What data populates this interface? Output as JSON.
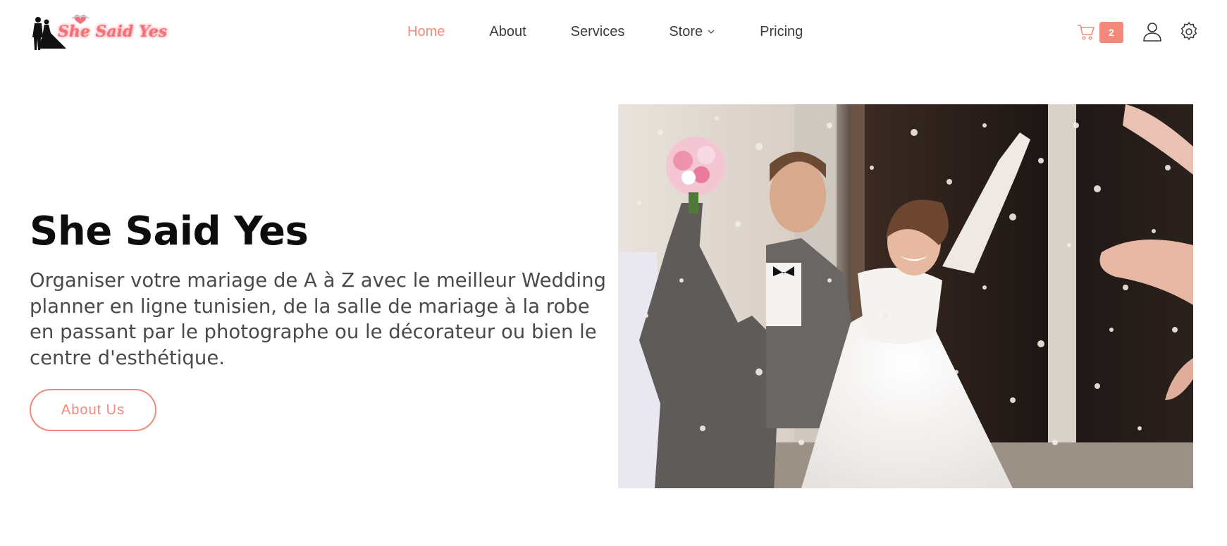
{
  "brand": {
    "name": "She Said Yes"
  },
  "nav": {
    "items": [
      {
        "label": "Home",
        "active": true
      },
      {
        "label": "About",
        "active": false
      },
      {
        "label": "Services",
        "active": false
      },
      {
        "label": "Store",
        "active": false,
        "has_dropdown": true
      },
      {
        "label": "Pricing",
        "active": false
      }
    ]
  },
  "header": {
    "cart_count": "2",
    "icons": [
      "cart-icon",
      "user-icon",
      "gear-icon"
    ]
  },
  "hero": {
    "title": "She Said Yes",
    "description": "Organiser votre mariage de A à Z avec le meilleur Wedding planner en ligne tunisien, de la salle de mariage à la robe en passant par le photographe ou le décorateur ou bien le centre d'esthétique.",
    "button_label": "About Us",
    "image_alt": "bride-and-groom-photo"
  },
  "colors": {
    "accent": "#f08b79",
    "badge": "#f2897a",
    "title": "#0d0d0d",
    "body_text": "#4a4a4a",
    "nav_text": "#3b3b3b"
  }
}
